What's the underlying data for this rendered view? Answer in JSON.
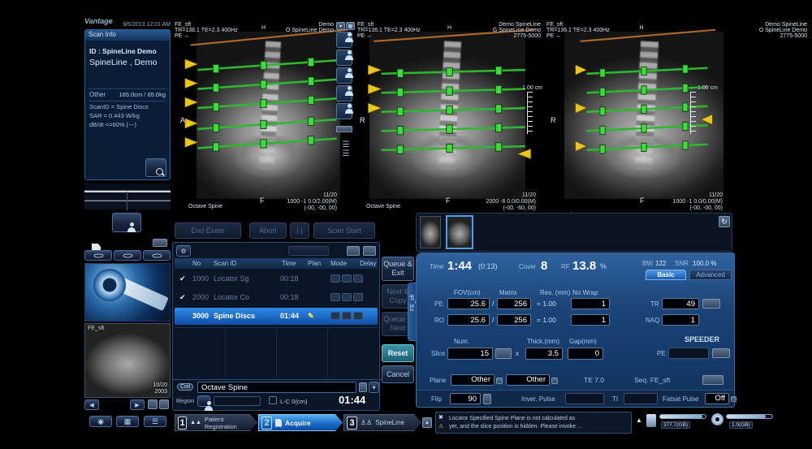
{
  "window": {
    "brand": "Vantage",
    "datetime": "9/6/2013 12:01 AM"
  },
  "icons": {
    "check": "✔",
    "pencil": "✎",
    "plus": "+",
    "prev": "◀",
    "next": "▶",
    "up": "▲",
    "down": "▼",
    "close": "✖",
    "warning": "⚠",
    "refresh": "↻",
    "menu": "☰",
    "grid": "▦",
    "power": "◉",
    "pause": "| |",
    "persons": "♙♙",
    "beds": "▲▲"
  },
  "scan_info": {
    "title": "Scan Info",
    "id_line": "ID : SpineLine Demo",
    "patient_name": "SpineLine , Demo",
    "other_label": "Other",
    "body_stats": "165.0cm / 65.0kg",
    "scan_id": "ScanID = Spine Discs",
    "sar": "SAR = 0.443 W/kg",
    "dbdt": "dB/dt <=60% (---)"
  },
  "sidebar": {
    "thumb_label": "FE_sft",
    "thumb_counter": "10/20",
    "thumb_year": "2003"
  },
  "viewports": [
    {
      "seq": "FE_sft",
      "params": "TR=136.1 TE=2.3 400Hz",
      "pe": "PE ↔",
      "top_center": "H",
      "right1": "Demo",
      "right2": "O SpineLine Demo",
      "right3": "",
      "left_letter": "A",
      "bottom_letter": "F",
      "counter": "11/20",
      "pos": "1000 -1 0.0/2.00(M)",
      "coords": "(-00, -00, 00)",
      "series": "Octave Spine",
      "ruler": ""
    },
    {
      "seq": "FE_sft",
      "params": "TR=136.1 TE=2.3 400Hz",
      "pe": "PE ↔",
      "top_center": "H",
      "right1": "Demo SpineLine",
      "right2": "G SpineLine Demo",
      "right3": "2775-5000",
      "left_letter": "R",
      "bottom_letter": "F",
      "counter": "11/20",
      "pos": "2000 -8 0.0/0.00(M)",
      "coords": "(-00, -60, 00)",
      "series": "Octave Spine",
      "ruler": "1.00 cm"
    },
    {
      "seq": "FE_sft",
      "params": "TR=136.1 TE=2.3 400Hz",
      "pe": "PE ↔",
      "top_center": "H",
      "right1": "Demo SpineLine",
      "right2": "O SpineLine Demo",
      "right3": "2775-5000",
      "left_letter": "R",
      "bottom_letter": "F",
      "counter": "11/20",
      "pos": "1000 -1 0.0/0.00(M)",
      "coords": "(-00, -00, 00)",
      "series": "Octave Spine",
      "ruler": "1.00 cm"
    }
  ],
  "scan_controls": {
    "end_exam": "End Exam",
    "abort": "Abort",
    "pause": "| |",
    "scan_start": "Scan Start"
  },
  "queue": {
    "headers": {
      "no": "No",
      "scan_id": "Scan ID",
      "time": "Time",
      "plan": "Plan",
      "mode": "Mode",
      "delay": "Delay"
    },
    "rows": [
      {
        "check": "✔",
        "no": "1000",
        "scan_id": "Locator Sg",
        "time": "00:18",
        "plan": ""
      },
      {
        "check": "✔",
        "no": "2000",
        "scan_id": "Locator Co",
        "time": "00:18",
        "plan": ""
      },
      {
        "check": "",
        "no": "3000",
        "scan_id": "Spine Discs",
        "time": "01:44",
        "plan": "✎"
      }
    ],
    "coil_label": "Coil",
    "coil_value": "Octave Spine",
    "add": "+",
    "region_label": "Region",
    "lc_label": "L-C 0(cm)",
    "total_time": "01:44"
  },
  "actions": {
    "queue_exit": "Queue & Exit",
    "next_copy": "Next & Copy",
    "queue_next": "Queue & Next",
    "reset": "Reset",
    "cancel": "Cancel"
  },
  "params": {
    "tab_label": "FE_sft",
    "time_label": "Time",
    "time_value": "1:44",
    "time_extra": "(0:13)",
    "cover_label": "Cover",
    "cover_value": "8",
    "rf_label": "RF",
    "rf_value": "13.8",
    "rf_unit": "%",
    "bw_label": "BW",
    "bw_value": "122",
    "snr_label": "SNR",
    "snr_value": "100.0 %",
    "tabs": {
      "basic": "Basic",
      "advanced": "Advanced"
    },
    "grid": {
      "fov": "FOV(cm)",
      "matrix": "Matrix",
      "res": "Res. (mm)",
      "nowrap": "No Wrap",
      "pe_label": "PE",
      "pe_fov": "25.6",
      "slash": "/",
      "pe_matrix": "256",
      "pe_res": "=  1.00",
      "pe_nowrap": "1",
      "ro_label": "RO",
      "ro_fov": "25.6",
      "ro_matrix": "256",
      "ro_res": "=  1.00",
      "ro_nowrap": "1",
      "tr_label": "TR",
      "tr_value": "49",
      "naq_label": "NAQ",
      "naq_value": "1",
      "num": "Num.",
      "slice_label": "Slice",
      "slice_value": "15",
      "x": "x",
      "thick": "Thick.(mm)",
      "thick_value": "3.5",
      "gap": "Gap(mm)",
      "gap_value": "0",
      "speeder": "SPEEDER",
      "speeder_pe": "PE",
      "plane_label": "Plane",
      "plane1": "Other",
      "plane2": "Other",
      "te": "TE 7.0",
      "seq": "Seq. FE_sft",
      "flip_label": "Flip",
      "flip_value": "90",
      "inver": "Inver. Pulse",
      "ti": "TI",
      "fatsat": "Fatsat Pulse",
      "fatsat_value": "Off"
    }
  },
  "bottom": {
    "tab1_num": "1",
    "tab1_label": "Patient Registration",
    "tab2_num": "2",
    "tab2_label": "Acquire",
    "tab3_num": "3",
    "tab3_label": "SpineLine",
    "message_line1": "Locator Specified Spine Plane is not calculated as",
    "message_line2": "yet, and the slice position is hidden. Please invoke ...",
    "disk1": "377.7(GB)",
    "disk2": "1.0(GB)"
  }
}
